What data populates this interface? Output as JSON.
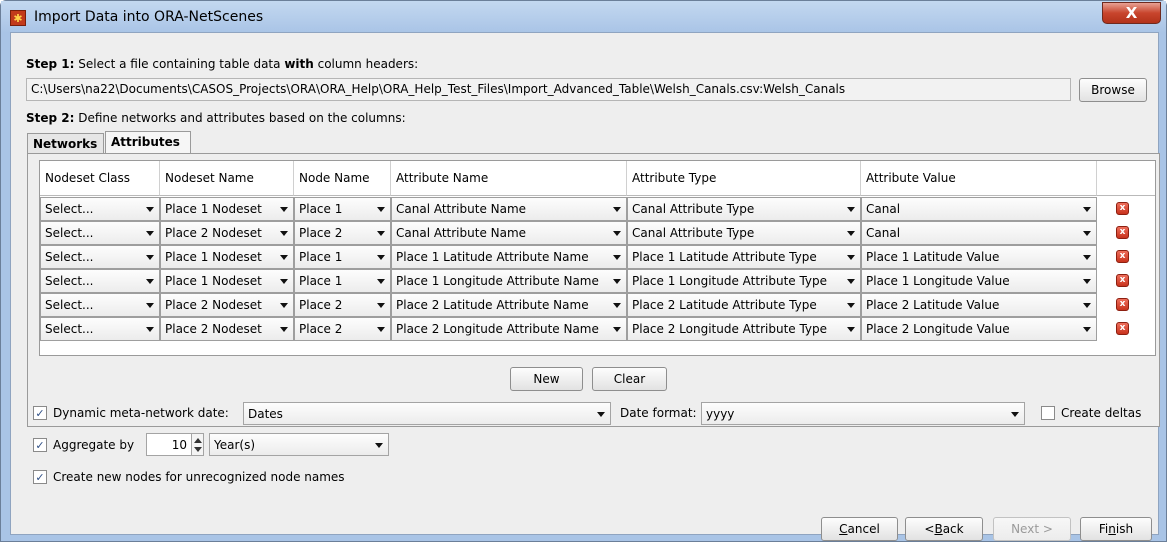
{
  "window": {
    "title": "Import Data into ORA-NetScenes",
    "close_glyph": "X",
    "app_icon": "ora-app-icon"
  },
  "step1": {
    "bold": "Step 1:",
    "text_a": " Select a file containing table data ",
    "bold_with": "with",
    "text_b": " column headers:",
    "path": "C:\\Users\\na22\\Documents\\CASOS_Projects\\ORA\\ORA_Help\\ORA_Help_Test_Files\\Import_Advanced_Table\\Welsh_Canals.csv:Welsh_Canals",
    "browse_label": "Browse"
  },
  "step2": {
    "bold": "Step 2:",
    "text": " Define networks and attributes based on the columns:"
  },
  "tabs": [
    {
      "label": "Networks",
      "active": false
    },
    {
      "label": "Attributes",
      "active": true
    }
  ],
  "table": {
    "headers": [
      "Nodeset Class",
      "Nodeset Name",
      "Node Name",
      "Attribute Name",
      "Attribute Type",
      "Attribute Value"
    ],
    "rows": [
      [
        "Select...",
        "Place 1 Nodeset",
        "Place 1",
        "Canal Attribute Name",
        "Canal Attribute Type",
        "Canal"
      ],
      [
        "Select...",
        "Place 2 Nodeset",
        "Place 2",
        "Canal Attribute Name",
        "Canal Attribute Type",
        "Canal"
      ],
      [
        "Select...",
        "Place 1 Nodeset",
        "Place 1",
        "Place 1 Latitude Attribute Name",
        "Place 1 Latitude Attribute Type",
        "Place 1 Latitude Value"
      ],
      [
        "Select...",
        "Place 1 Nodeset",
        "Place 1",
        "Place 1 Longitude Attribute Name",
        "Place 1 Longitude Attribute Type",
        "Place 1 Longitude Value"
      ],
      [
        "Select...",
        "Place 2 Nodeset",
        "Place 2",
        "Place 2 Latitude Attribute Name",
        "Place 2 Latitude Attribute Type",
        "Place 2 Latitude Value"
      ],
      [
        "Select...",
        "Place 2 Nodeset",
        "Place 2",
        "Place 2 Longitude Attribute Name",
        "Place 2 Longitude Attribute Type",
        "Place 2 Longitude Value"
      ]
    ],
    "delete_glyph": "x"
  },
  "table_buttons": {
    "new_label": "New",
    "clear_label": "Clear"
  },
  "options": {
    "dynamic_date": {
      "checked": true,
      "label": "Dynamic meta-network date:",
      "value": "Dates"
    },
    "date_format": {
      "label": "Date format:",
      "value": "yyyy"
    },
    "create_deltas": {
      "checked": false,
      "label": "Create deltas"
    },
    "aggregate": {
      "checked": true,
      "label": "Aggregate by",
      "amount": "10",
      "unit": "Year(s)"
    },
    "create_nodes": {
      "checked": true,
      "label": "Create new nodes for unrecognized node names"
    },
    "check_glyph": "✓"
  },
  "footer": {
    "cancel": {
      "pre": "",
      "mnemonic": "C",
      "post": "ancel"
    },
    "back": {
      "pre": "< ",
      "mnemonic": "B",
      "post": "ack"
    },
    "next": {
      "label": "Next >"
    },
    "finish": {
      "pre": "Fi",
      "mnemonic": "n",
      "post": "ish"
    }
  }
}
